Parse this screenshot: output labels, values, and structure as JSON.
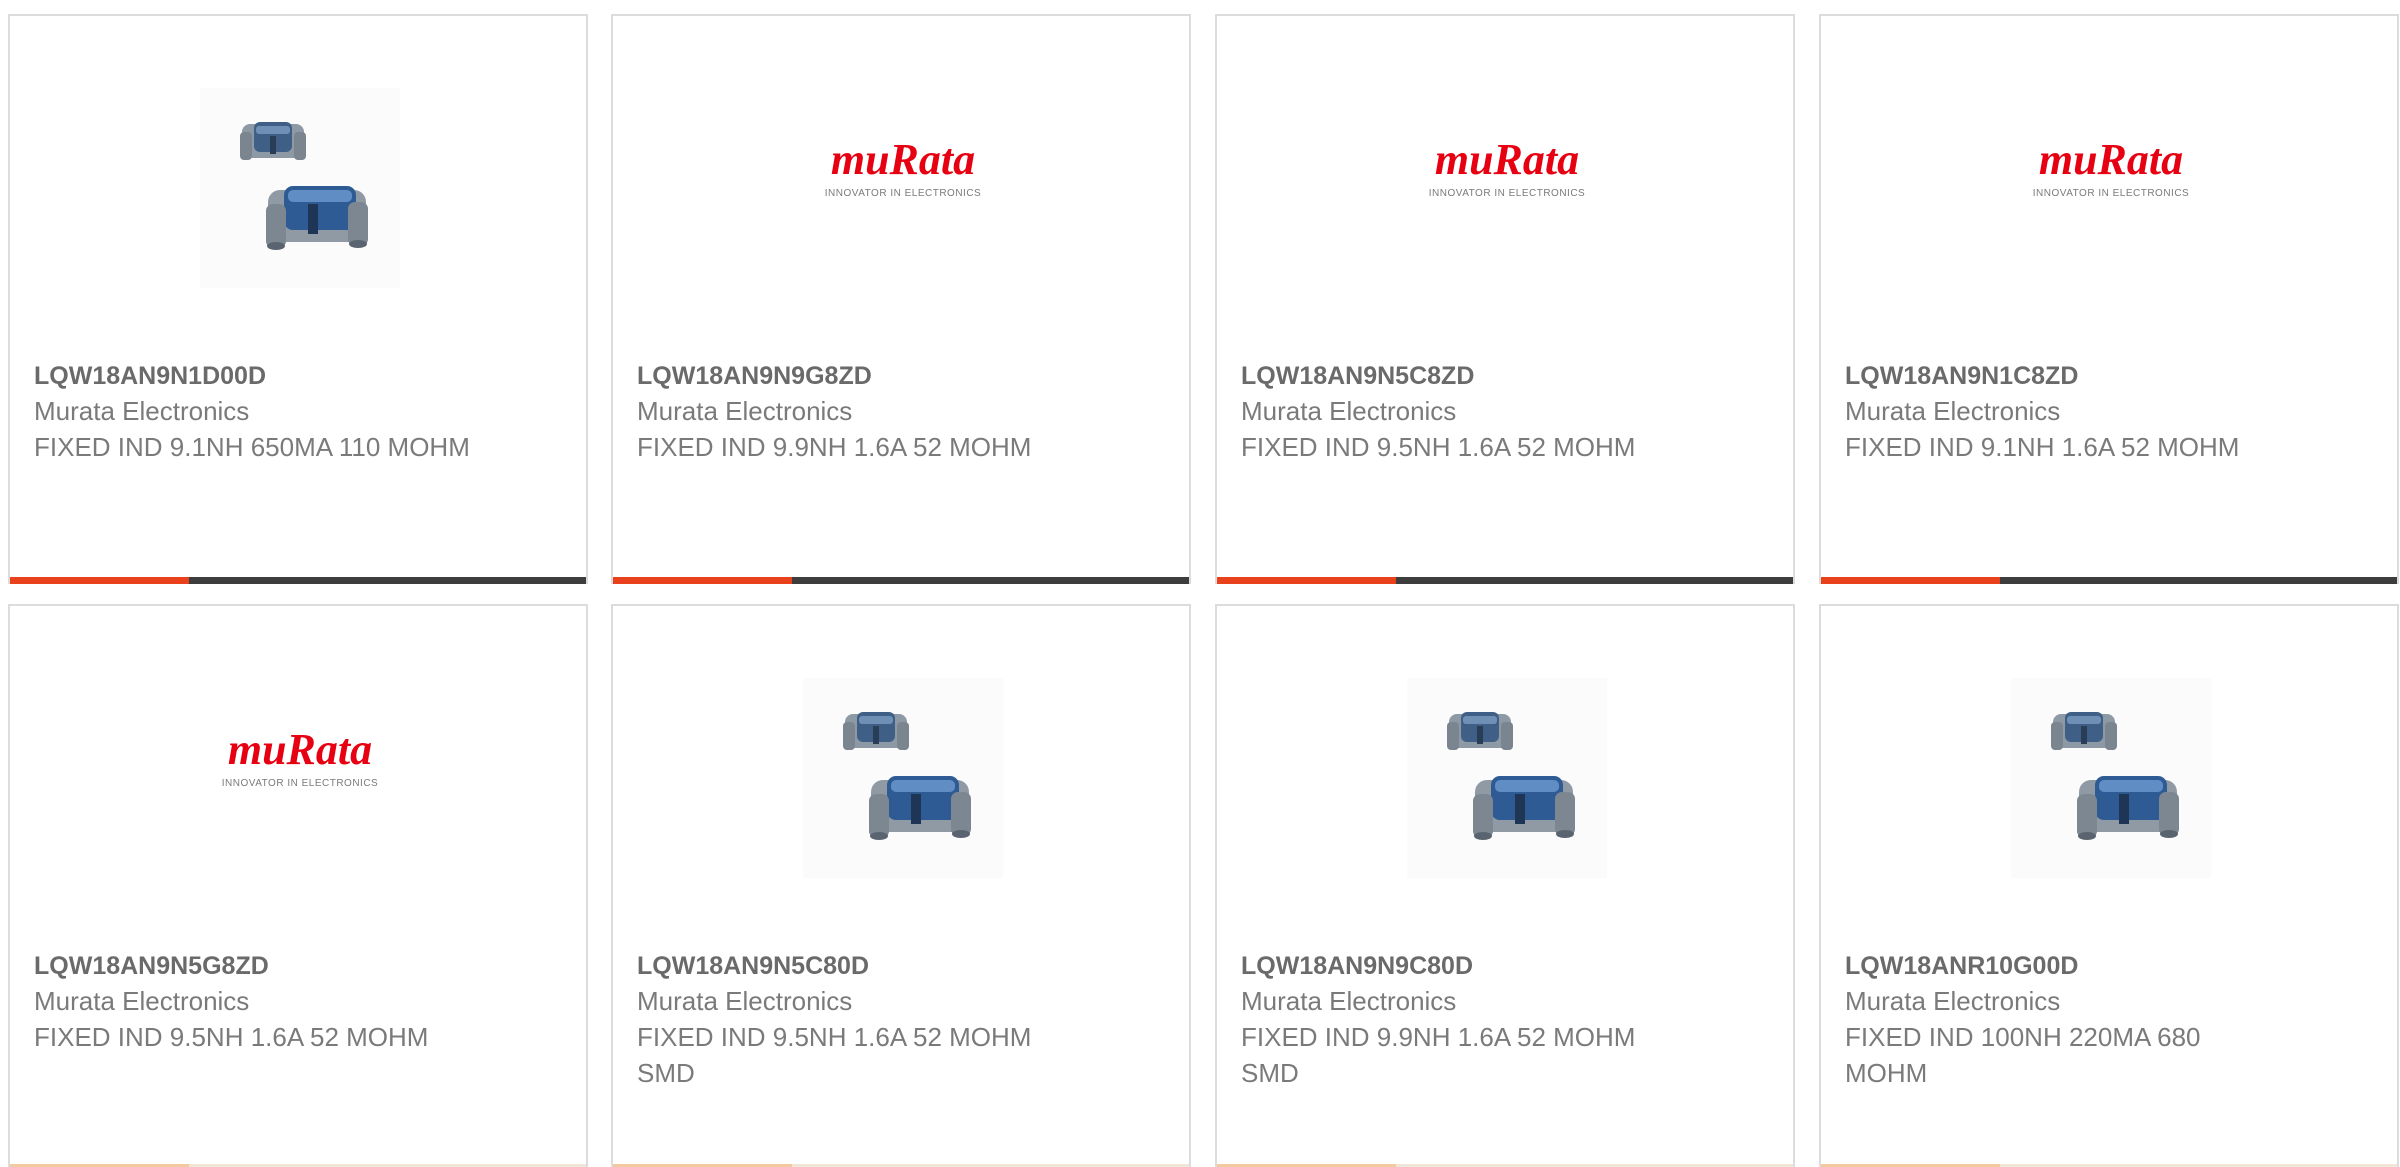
{
  "products": [
    {
      "part_number": "LQW18AN9N1D00D",
      "manufacturer": "Murata Electronics",
      "description": "FIXED IND 9.1NH 650MA 110 MOHM",
      "image": "inductor-photo",
      "progress": 0.31
    },
    {
      "part_number": "LQW18AN9N9G8ZD",
      "manufacturer": "Murata Electronics",
      "description": "FIXED IND 9.9NH 1.6A 52 MOHM",
      "image": "murata-logo",
      "logo_text": "muRata",
      "logo_tagline": "INNOVATOR IN ELECTRONICS",
      "progress": 0.31
    },
    {
      "part_number": "LQW18AN9N5C8ZD",
      "manufacturer": "Murata Electronics",
      "description": "FIXED IND 9.5NH 1.6A 52 MOHM",
      "image": "murata-logo",
      "logo_text": "muRata",
      "logo_tagline": "INNOVATOR IN ELECTRONICS",
      "progress": 0.31
    },
    {
      "part_number": "LQW18AN9N1C8ZD",
      "manufacturer": "Murata Electronics",
      "description": "FIXED IND 9.1NH 1.6A 52 MOHM",
      "image": "murata-logo",
      "logo_text": "muRata",
      "logo_tagline": "INNOVATOR IN ELECTRONICS",
      "progress": 0.31
    },
    {
      "part_number": "LQW18AN9N5G8ZD",
      "manufacturer": "Murata Electronics",
      "description": "FIXED IND 9.5NH 1.6A 52 MOHM",
      "image": "murata-logo",
      "logo_text": "muRata",
      "logo_tagline": "INNOVATOR IN ELECTRONICS",
      "progress": 0.31
    },
    {
      "part_number": "LQW18AN9N5C80D",
      "manufacturer": "Murata Electronics",
      "description": "FIXED IND 9.5NH 1.6A 52 MOHM SMD",
      "image": "inductor-photo",
      "progress": 0.31
    },
    {
      "part_number": "LQW18AN9N9C80D",
      "manufacturer": "Murata Electronics",
      "description": "FIXED IND 9.9NH 1.6A 52 MOHM SMD",
      "image": "inductor-photo",
      "progress": 0.31
    },
    {
      "part_number": "LQW18ANR10G00D",
      "manufacturer": "Murata Electronics",
      "description": "FIXED IND 100NH 220MA 680 MOHM",
      "image": "inductor-photo",
      "progress": 0.31
    }
  ],
  "colors": {
    "accent": "#e8411c",
    "bar_track": "#3d3d3d",
    "logo_red": "#e60012",
    "text": "#707070"
  }
}
